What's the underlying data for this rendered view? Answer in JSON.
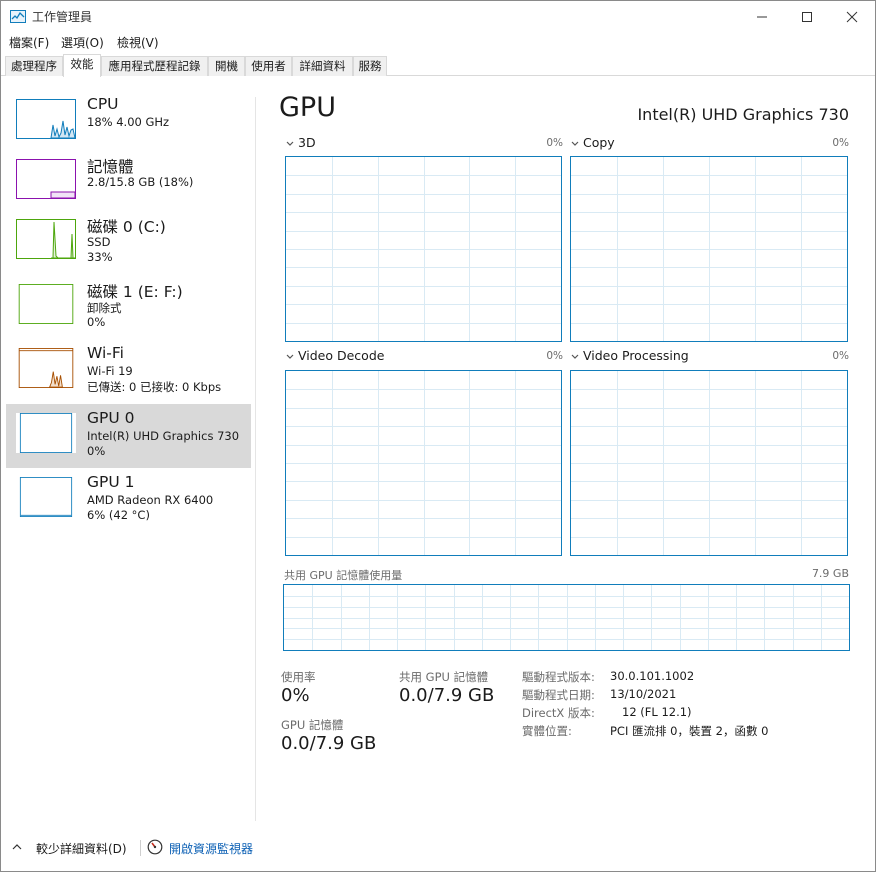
{
  "window": {
    "title": "工作管理員",
    "menu": [
      "檔案(F)",
      "選項(O)",
      "檢視(V)"
    ],
    "tabs": [
      "處理程序",
      "效能",
      "應用程式歷程記錄",
      "開機",
      "使用者",
      "詳細資料",
      "服務"
    ],
    "active_tab": "效能"
  },
  "resources": [
    {
      "title": "CPU",
      "lines": [
        "18% 4.00 GHz"
      ],
      "color": "#117dbb"
    },
    {
      "title": "記憶體",
      "lines": [
        "2.8/15.8 GB (18%)"
      ],
      "color": "#8b12ae"
    },
    {
      "title": "磁碟 0 (C:)",
      "lines": [
        "SSD",
        "33%"
      ],
      "color": "#4da60c"
    },
    {
      "title": "磁碟 1 (E: F:)",
      "lines": [
        "卸除式",
        "0%"
      ],
      "color": "#4da60c"
    },
    {
      "title": "Wi-Fi",
      "lines": [
        "Wi-Fi 19",
        "已傳送: 0 已接收: 0 Kbps"
      ],
      "color": "#a74f01"
    },
    {
      "title": "GPU 0",
      "lines": [
        "Intel(R) UHD Graphics 730",
        "0%"
      ],
      "color": "#117dbb",
      "selected": true
    },
    {
      "title": "GPU 1",
      "lines": [
        "AMD Radeon RX 6400",
        "6% (42 °C)"
      ],
      "color": "#117dbb"
    }
  ],
  "detail": {
    "title": "GPU",
    "device_name": "Intel(R) UHD Graphics 730",
    "engines": [
      {
        "name": "3D",
        "percent": "0%"
      },
      {
        "name": "Copy",
        "percent": "0%"
      },
      {
        "name": "Video Decode",
        "percent": "0%"
      },
      {
        "name": "Video Processing",
        "percent": "0%"
      }
    ],
    "shared_memory_graph": {
      "label": "共用 GPU 記憶體使用量",
      "max": "7.9 GB"
    },
    "stats": {
      "utilization_label": "使用率",
      "utilization_value": "0%",
      "shared_mem_label": "共用 GPU 記憶體",
      "shared_mem_value": "0.0/7.9 GB",
      "gpu_mem_label": "GPU 記憶體",
      "gpu_mem_value": "0.0/7.9 GB"
    },
    "info": [
      {
        "label": "驅動程式版本:",
        "value": "30.0.101.1002"
      },
      {
        "label": "驅動程式日期:",
        "value": "13/10/2021"
      },
      {
        "label": "DirectX 版本:",
        "value": "12 (FL 12.1)"
      },
      {
        "label": "實體位置:",
        "value": "PCI 匯流排 0，裝置 2，函數 0"
      }
    ]
  },
  "footer": {
    "fewer_details": "較少詳細資料(D)",
    "open_resource_monitor": "開啟資源監視器"
  },
  "colors": {
    "accent_blue": "#117dbb",
    "grid_line": "#d9eaf4",
    "selected_bg": "#d9d9d9"
  }
}
